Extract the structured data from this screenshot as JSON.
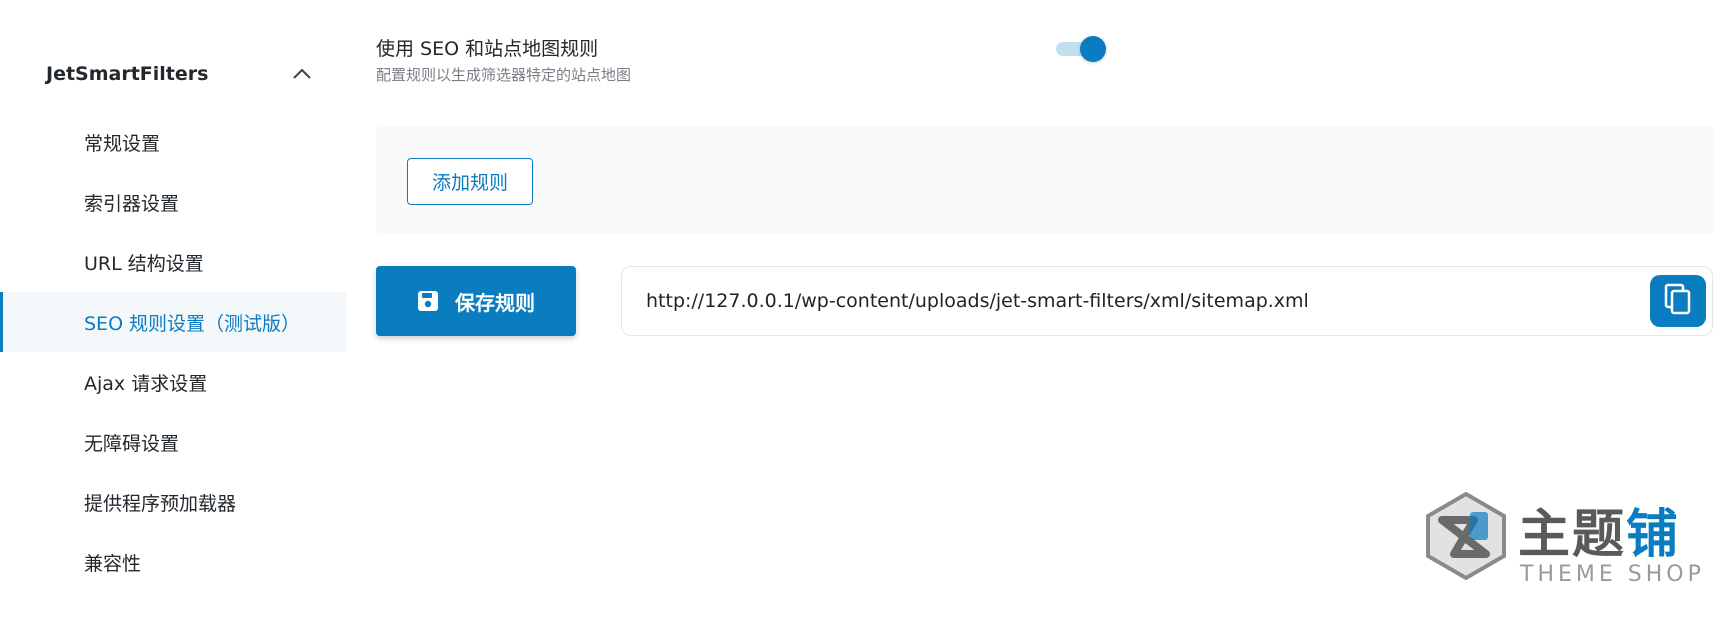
{
  "sidebar": {
    "title": "JetSmartFilters",
    "items": [
      {
        "label": "常规设置"
      },
      {
        "label": "索引器设置"
      },
      {
        "label": "URL 结构设置"
      },
      {
        "label": "SEO 规则设置（测试版）"
      },
      {
        "label": "Ajax 请求设置"
      },
      {
        "label": "无障碍设置"
      },
      {
        "label": "提供程序预加载器"
      },
      {
        "label": "兼容性"
      }
    ],
    "active_index": 3
  },
  "setting": {
    "title": "使用 SEO 和站点地图规则",
    "description": "配置规则以生成筛选器特定的站点地图",
    "enabled": true
  },
  "rules": {
    "add_label": "添加规则"
  },
  "save": {
    "label": "保存规则"
  },
  "sitemap": {
    "url": "http://127.0.0.1/wp-content/uploads/jet-smart-filters/xml/sitemap.xml"
  },
  "watermark": {
    "cn_main": "主题",
    "cn_accent": "铺",
    "en": "THEME SHOP"
  },
  "colors": {
    "accent": "#0a7cc0",
    "panel_bg": "#fafafa",
    "text": "#23282d",
    "muted": "#7b7e86"
  }
}
